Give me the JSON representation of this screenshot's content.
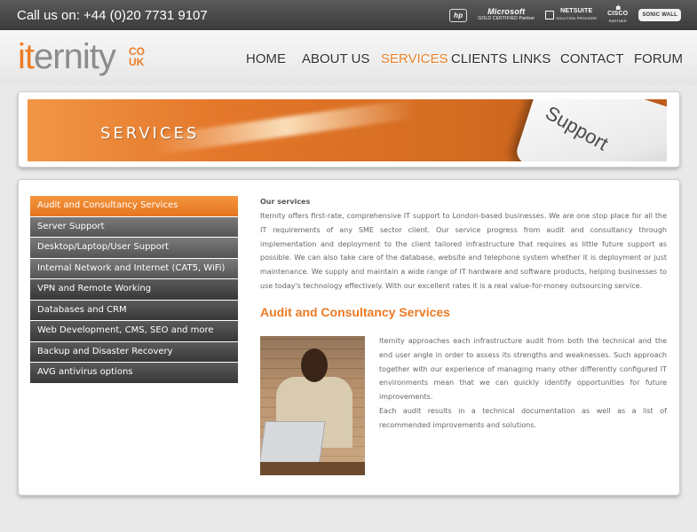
{
  "topbar": {
    "phone": "Call us on: +44 (0)20 7731 9107",
    "partners": [
      {
        "name": "hp-logo",
        "text": "hp"
      },
      {
        "name": "microsoft-gold-certified-logo",
        "text": "Microsoft",
        "sub": "GOLD CERTIFIED Partner"
      },
      {
        "name": "netsuite-logo",
        "text": "NETSUITE",
        "sub": "SOLUTION PROVIDER"
      },
      {
        "name": "cisco-logo",
        "text": "CISCO",
        "sub": "PARTNER"
      },
      {
        "name": "sonicwall-logo",
        "text": "SONIC WALL"
      }
    ]
  },
  "logo": {
    "it": "it",
    "rest": "ernity",
    "tld_top": "CO",
    "tld_bottom": "UK"
  },
  "nav": [
    {
      "label": "HOME",
      "active": false
    },
    {
      "label": "ABOUT US",
      "active": false
    },
    {
      "label": "SERVICES",
      "active": true
    },
    {
      "label": "CLIENTS",
      "active": false
    },
    {
      "label": "LINKS",
      "active": false
    },
    {
      "label": "CONTACT",
      "active": false
    },
    {
      "label": "FORUM",
      "active": false
    }
  ],
  "banner": {
    "title": "SERVICES",
    "key_label": "Support"
  },
  "side_menu": [
    "Audit and Consultancy Services",
    "Server Support",
    "Desktop/Laptop/User Support",
    "Internal Network and Internet (CAT5, WiFi)",
    "VPN and Remote Working",
    "Databases and CRM",
    "Web Development, CMS, SEO and more",
    "Backup and Disaster Recovery",
    "AVG antivirus options"
  ],
  "main": {
    "label": "Our services",
    "intro": "Iternity offers first-rate, comprehensive IT support to London-based businesses. We are one stop place for all the IT requirements of any SME sector client. Our service progress from audit and consultancy through implementation and deployment to the client tailored infrastructure that requires as little future support as possible. We can also take care of the database, website and telephone system whether it is deployment or just maintenance. We supply and maintain a wide range of IT hardware and software products, helping businesses to use today's technology effectively. With our excellent rates it is a real value-for-money outsourcing service.",
    "heading": "Audit and Consultancy Services",
    "body_1": "Iternity approaches each infrastructure audit from both the technical and the end user angle in order to assess its strengths and weaknesses. Such approach together with our experience of managing many other differently configured IT environments mean that we can quickly identify opportunities for future improvements.",
    "body_2": "Each audit results in a technical documentation as well as a list of recommended improvements and solutions."
  },
  "colors": {
    "accent": "#ee7c26",
    "menu_active": "#e8822a",
    "topbar": "#454545"
  }
}
